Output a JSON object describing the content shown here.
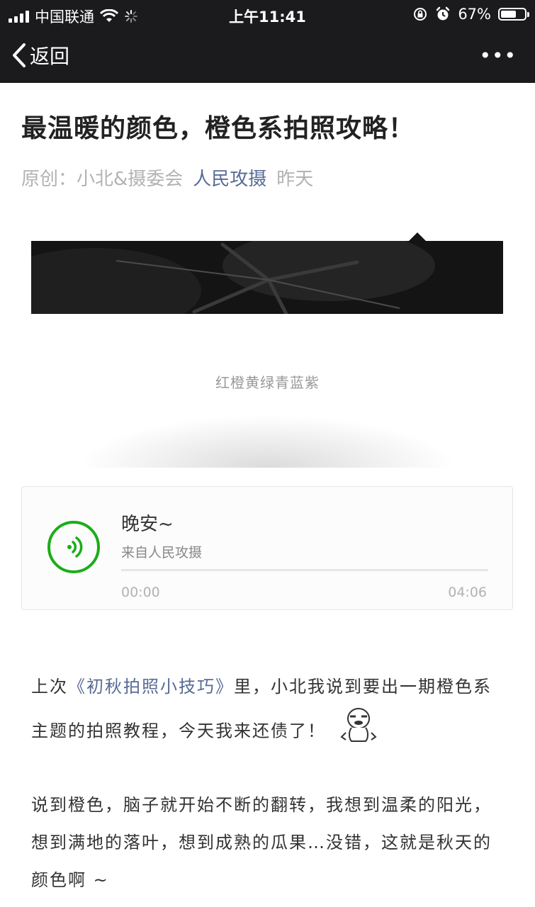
{
  "status_bar": {
    "carrier": "中国联通",
    "time": "上午11:41",
    "battery_percent": "67%",
    "battery_level": 0.67
  },
  "nav": {
    "back_label": "返回",
    "more_label": "•••"
  },
  "article": {
    "title": "最温暖的颜色，橙色系拍照攻略！",
    "meta_original": "原创：小北&摄委会",
    "meta_account": "人民攻摄",
    "meta_date": "昨天",
    "image_caption": "红橙黄绿青蓝紫"
  },
  "audio": {
    "title": "晚安~",
    "source": "来自人民攻摄",
    "current_time": "00:00",
    "duration": "04:06",
    "progress": 0
  },
  "body": {
    "p1_prefix": "上次",
    "p1_link": "《初秋拍照小技巧》",
    "p1_suffix": "里，小北我说到要出一期橙色系主题的拍照教程，今天我来还债了！",
    "p2": "说到橙色，脑子就开始不断的翻转，我想到温柔的阳光，想到满地的落叶，想到成熟的瓜果…没错，这就是秋天的颜色啊 ~"
  },
  "colors": {
    "bar_bg": "#1b1b1e",
    "link": "#576b95",
    "accent_green": "#1aad19"
  }
}
